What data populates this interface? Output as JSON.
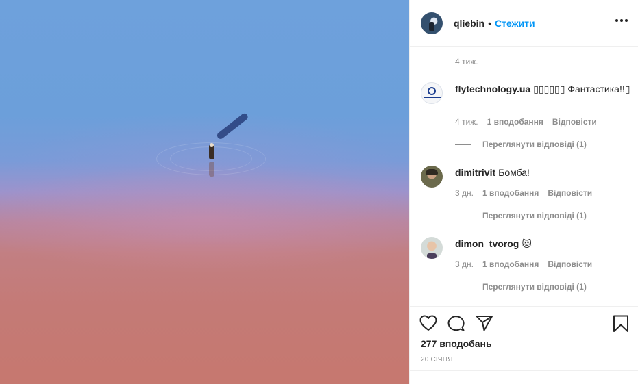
{
  "post": {
    "image_alt": "",
    "header": {
      "username": "qliebin",
      "separator": "•",
      "follow_label": "Стежити"
    },
    "top_time": "4 тиж.",
    "comments": [
      {
        "username": "flytechnology.ua",
        "text": "▯▯▯▯▯▯ Фантастика!!▯",
        "time": "4 тиж.",
        "likes": "1 вподобання",
        "reply_label": "Відповісти",
        "view_replies": "Переглянути відповіді (1)",
        "avatar_icon": "flytechnology-logo-icon"
      },
      {
        "username": "dimitrivit",
        "text": "Бомба!",
        "time": "3 дн.",
        "likes": "1 вподобання",
        "reply_label": "Відповісти",
        "view_replies": "Переглянути відповіді (1)",
        "avatar_icon": "user-avatar-icon"
      },
      {
        "username": "dimon_tvorog",
        "text": "😻",
        "time": "3 дн.",
        "likes": "1 вподобання",
        "reply_label": "Відповісти",
        "view_replies": "Переглянути відповіді (1)",
        "avatar_icon": "user-avatar-icon"
      }
    ],
    "actions": {
      "like_icon": "heart-icon",
      "comment_icon": "comment-icon",
      "share_icon": "share-icon",
      "save_icon": "bookmark-icon"
    },
    "likes_count": "277 вподобань",
    "date": "20 січня"
  },
  "colors": {
    "link_blue": "#0095f6",
    "secondary_text": "#8e8e8e",
    "primary_text": "#262626",
    "border": "#efefef"
  }
}
